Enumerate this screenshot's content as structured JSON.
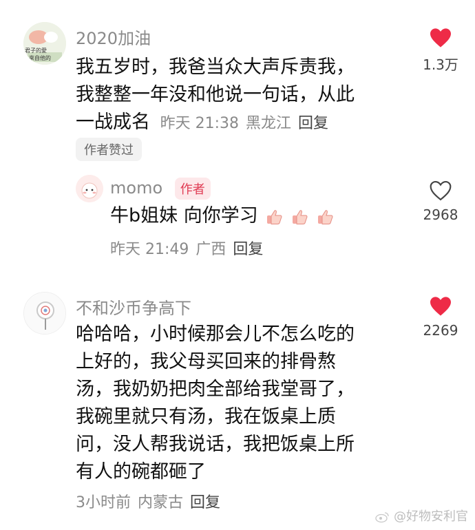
{
  "comments": [
    {
      "username": "2020加油",
      "avatar_text_1": "君子的愛",
      "avatar_text_2": "來自他的",
      "lines": [
        "我五岁时，我爸当众大声斥责我，",
        "我整整一年没和他说一句话，从此",
        "一战成名"
      ],
      "time": "昨天 21:38",
      "location": "黑龙江",
      "reply_label": "回复",
      "likes": "1.3万",
      "liked": true,
      "badge": "作者赞过"
    },
    {
      "username": "momo",
      "author_tag": "作者",
      "text": "牛b姐妹 向你学习",
      "emoji": [
        "thumbs-up",
        "thumbs-up",
        "thumbs-up"
      ],
      "time": "昨天 21:49",
      "location": "广西",
      "reply_label": "回复",
      "likes": "2968",
      "liked": false
    },
    {
      "username": "不和沙币争高下",
      "lines": [
        "哈哈哈，小时候那会儿不怎么吃的",
        "上好的，我父母买回来的排骨熬",
        "汤，我奶奶把肉全部给我堂哥了，",
        "我碗里就只有汤，我在饭桌上质",
        "问，没人帮我说话，我把饭桌上所",
        "有人的碗都砸了"
      ],
      "time": "3小时前",
      "location": "内蒙古",
      "reply_label": "回复",
      "likes": "2269",
      "liked": true
    }
  ],
  "watermark": "@好物安利官",
  "colors": {
    "heart_active": "#ee2b47",
    "meta_gray": "#8a8a8a"
  }
}
